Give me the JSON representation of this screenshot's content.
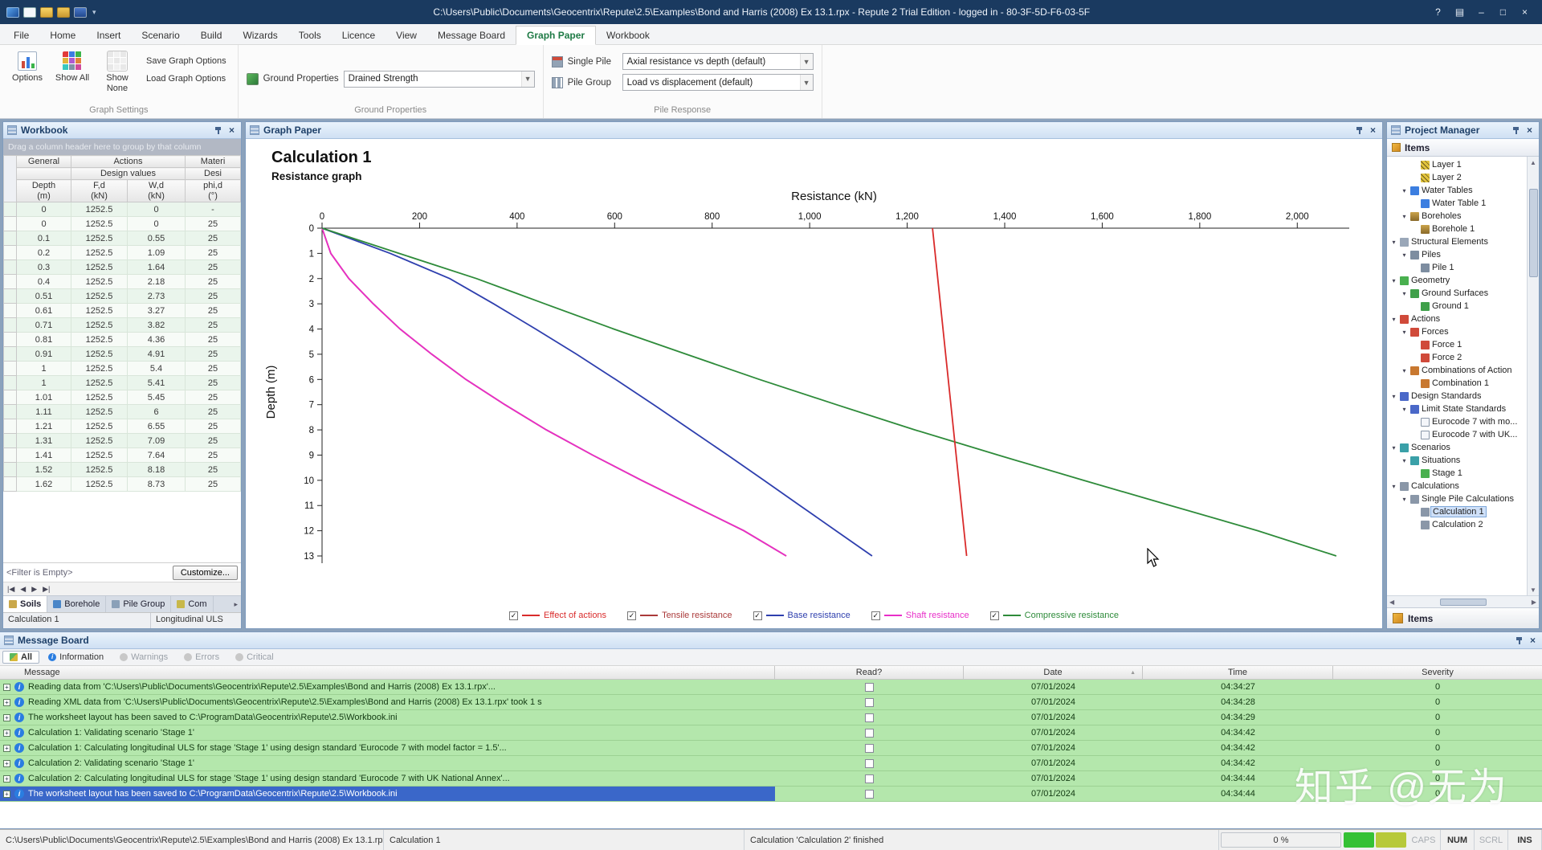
{
  "titlebar": {
    "title": "C:\\Users\\Public\\Documents\\Geocentrix\\Repute\\2.5\\Examples\\Bond and Harris (2008) Ex 13.1.rpx - Repute 2 Trial Edition - logged in - 80-3F-5D-F6-03-5F",
    "help": "?"
  },
  "menu": {
    "items": [
      "File",
      "Home",
      "Insert",
      "Scenario",
      "Build",
      "Wizards",
      "Tools",
      "Licence",
      "View",
      "Message Board",
      "Graph Paper",
      "Workbook"
    ],
    "active": "Graph Paper"
  },
  "ribbon": {
    "graph_settings": {
      "label": "Graph Settings",
      "options": "Options",
      "show_all": "Show All",
      "show_none": "Show None",
      "save": "Save Graph Options",
      "load": "Load Graph Options"
    },
    "ground_properties": {
      "label": "Ground Properties",
      "field_label": "Ground Properties",
      "value": "Drained Strength"
    },
    "pile_response": {
      "label": "Pile Response",
      "single_pile_label": "Single Pile",
      "single_pile_value": "Axial resistance vs depth (default)",
      "pile_group_label": "Pile Group",
      "pile_group_value": "Load vs displacement (default)"
    }
  },
  "workbook": {
    "title": "Workbook",
    "group_hint": "Drag a column header here to group by that column",
    "header": {
      "general": "General",
      "actions": "Actions",
      "materials": "Materi",
      "design_values": "Design values",
      "design2": "Desi"
    },
    "columns": [
      {
        "l1": "Depth",
        "l2": "(m)"
      },
      {
        "l1": "F,d",
        "l2": "(kN)"
      },
      {
        "l1": "W,d",
        "l2": "(kN)"
      },
      {
        "l1": "phi,d",
        "l2": "(°)"
      }
    ],
    "rows": [
      [
        "0",
        "1252.5",
        "0",
        "-"
      ],
      [
        "0",
        "1252.5",
        "0",
        "25"
      ],
      [
        "0.1",
        "1252.5",
        "0.55",
        "25"
      ],
      [
        "0.2",
        "1252.5",
        "1.09",
        "25"
      ],
      [
        "0.3",
        "1252.5",
        "1.64",
        "25"
      ],
      [
        "0.4",
        "1252.5",
        "2.18",
        "25"
      ],
      [
        "0.51",
        "1252.5",
        "2.73",
        "25"
      ],
      [
        "0.61",
        "1252.5",
        "3.27",
        "25"
      ],
      [
        "0.71",
        "1252.5",
        "3.82",
        "25"
      ],
      [
        "0.81",
        "1252.5",
        "4.36",
        "25"
      ],
      [
        "0.91",
        "1252.5",
        "4.91",
        "25"
      ],
      [
        "1",
        "1252.5",
        "5.4",
        "25"
      ],
      [
        "1",
        "1252.5",
        "5.41",
        "25"
      ],
      [
        "1.01",
        "1252.5",
        "5.45",
        "25"
      ],
      [
        "1.11",
        "1252.5",
        "6",
        "25"
      ],
      [
        "1.21",
        "1252.5",
        "6.55",
        "25"
      ],
      [
        "1.31",
        "1252.5",
        "7.09",
        "25"
      ],
      [
        "1.41",
        "1252.5",
        "7.64",
        "25"
      ],
      [
        "1.52",
        "1252.5",
        "8.18",
        "25"
      ],
      [
        "1.62",
        "1252.5",
        "8.73",
        "25"
      ]
    ],
    "filter": "<Filter is Empty>",
    "customize": "Customize...",
    "tabs": [
      "Soils",
      "Borehole",
      "Pile Group",
      "Com"
    ],
    "status_left": "Calculation 1",
    "status_right": "Longitudinal ULS"
  },
  "graph": {
    "panel_title": "Graph Paper"
  },
  "chart_data": {
    "type": "line",
    "title": "Calculation 1",
    "subtitle": "Resistance graph",
    "xlabel": "Resistance (kN)",
    "ylabel": "Depth (m)",
    "xlim": [
      0,
      2100
    ],
    "ylim": [
      0,
      13
    ],
    "x_ticks": [
      {
        "v": 0,
        "label": "0"
      },
      {
        "v": 200,
        "label": "200"
      },
      {
        "v": 400,
        "label": "400"
      },
      {
        "v": 600,
        "label": "600"
      },
      {
        "v": 800,
        "label": "800"
      },
      {
        "v": 1000,
        "label": "1,000"
      },
      {
        "v": 1200,
        "label": "1,200"
      },
      {
        "v": 1400,
        "label": "1,400"
      },
      {
        "v": 1600,
        "label": "1,600"
      },
      {
        "v": 1800,
        "label": "1,800"
      },
      {
        "v": 2000,
        "label": "2,000"
      }
    ],
    "y_ticks": [
      0,
      1,
      2,
      3,
      4,
      5,
      6,
      7,
      8,
      9,
      10,
      11,
      12,
      13
    ],
    "legend_position": "bottom",
    "grid": false,
    "series": [
      {
        "name": "Effect of actions",
        "color": "#d92b2b",
        "checked": true,
        "points": [
          [
            1252,
            0
          ],
          [
            1322,
            13
          ]
        ]
      },
      {
        "name": "Tensile resistance",
        "color": "#aa3a3a",
        "checked": true,
        "points": [
          [
            0,
            0
          ],
          [
            18,
            1
          ],
          [
            55,
            2
          ],
          [
            105,
            3
          ],
          [
            160,
            4
          ],
          [
            225,
            5
          ],
          [
            295,
            6
          ],
          [
            375,
            7
          ],
          [
            460,
            8
          ],
          [
            555,
            9
          ],
          [
            655,
            10
          ],
          [
            760,
            11
          ],
          [
            865,
            12
          ],
          [
            952,
            13
          ]
        ]
      },
      {
        "name": "Base resistance",
        "color": "#2e3fae",
        "checked": true,
        "points": [
          [
            0,
            0
          ],
          [
            140,
            1
          ],
          [
            262,
            2
          ],
          [
            352,
            3
          ],
          [
            438,
            4
          ],
          [
            522,
            5
          ],
          [
            602,
            6
          ],
          [
            680,
            7
          ],
          [
            756,
            8
          ],
          [
            832,
            9
          ],
          [
            906,
            10
          ],
          [
            980,
            11
          ],
          [
            1054,
            12
          ],
          [
            1128,
            13
          ]
        ]
      },
      {
        "name": "Shaft resistance",
        "color": "#e82ec8",
        "checked": true,
        "points": [
          [
            0,
            0
          ],
          [
            18,
            1
          ],
          [
            55,
            2
          ],
          [
            105,
            3
          ],
          [
            160,
            4
          ],
          [
            225,
            5
          ],
          [
            295,
            6
          ],
          [
            375,
            7
          ],
          [
            460,
            8
          ],
          [
            555,
            9
          ],
          [
            655,
            10
          ],
          [
            760,
            11
          ],
          [
            865,
            12
          ],
          [
            952,
            13
          ]
        ]
      },
      {
        "name": "Compressive resistance",
        "color": "#2e8b3a",
        "checked": true,
        "points": [
          [
            0,
            0
          ],
          [
            158,
            1
          ],
          [
            317,
            2
          ],
          [
            457,
            3
          ],
          [
            598,
            4
          ],
          [
            747,
            5
          ],
          [
            897,
            6
          ],
          [
            1055,
            7
          ],
          [
            1216,
            8
          ],
          [
            1387,
            9
          ],
          [
            1561,
            10
          ],
          [
            1740,
            11
          ],
          [
            1919,
            12
          ],
          [
            2080,
            13
          ]
        ]
      }
    ]
  },
  "project_manager": {
    "title": "Project Manager",
    "items_header": "Items",
    "items_button": "Items",
    "tree": [
      {
        "label": "Layer 1",
        "level": 2,
        "icon": "layer"
      },
      {
        "label": "Layer 2",
        "level": 2,
        "icon": "layer"
      },
      {
        "label": "Water Tables",
        "level": 1,
        "icon": "water-tables",
        "expand": true
      },
      {
        "label": "Water Table 1",
        "level": 2,
        "icon": "water-table"
      },
      {
        "label": "Boreholes",
        "level": 1,
        "icon": "boreholes",
        "expand": true
      },
      {
        "label": "Borehole 1",
        "level": 2,
        "icon": "borehole"
      },
      {
        "label": "Structural Elements",
        "level": 0,
        "icon": "structural",
        "expand": true
      },
      {
        "label": "Piles",
        "level": 1,
        "icon": "piles",
        "expand": true
      },
      {
        "label": "Pile 1",
        "level": 2,
        "icon": "pile"
      },
      {
        "label": "Geometry",
        "level": 0,
        "icon": "geometry",
        "expand": true
      },
      {
        "label": "Ground Surfaces",
        "level": 1,
        "icon": "ground-surfaces",
        "expand": true
      },
      {
        "label": "Ground 1",
        "level": 2,
        "icon": "ground"
      },
      {
        "label": "Actions",
        "level": 0,
        "icon": "actions",
        "expand": true
      },
      {
        "label": "Forces",
        "level": 1,
        "icon": "forces",
        "expand": true
      },
      {
        "label": "Force 1",
        "level": 2,
        "icon": "force"
      },
      {
        "label": "Force 2",
        "level": 2,
        "icon": "force"
      },
      {
        "label": "Combinations of Action",
        "level": 1,
        "icon": "combinations",
        "expand": true
      },
      {
        "label": "Combination 1",
        "level": 2,
        "icon": "combination"
      },
      {
        "label": "Design Standards",
        "level": 0,
        "icon": "design-standards",
        "expand": true
      },
      {
        "label": "Limit State Standards",
        "level": 1,
        "icon": "limit-state",
        "expand": true
      },
      {
        "label": "Eurocode 7 with mo...",
        "level": 2,
        "icon": "eurocode"
      },
      {
        "label": "Eurocode 7 with UK...",
        "level": 2,
        "icon": "eurocode"
      },
      {
        "label": "Scenarios",
        "level": 0,
        "icon": "scenarios",
        "expand": true
      },
      {
        "label": "Situations",
        "level": 1,
        "icon": "situations",
        "expand": true
      },
      {
        "label": "Stage 1",
        "level": 2,
        "icon": "stage"
      },
      {
        "label": "Calculations",
        "level": 0,
        "icon": "calculations",
        "expand": true
      },
      {
        "label": "Single Pile Calculations",
        "level": 1,
        "icon": "single-pile",
        "expand": true
      },
      {
        "label": "Calculation 1",
        "level": 2,
        "icon": "calculation",
        "selected": true
      },
      {
        "label": "Calculation 2",
        "level": 2,
        "icon": "calculation"
      }
    ]
  },
  "message_board": {
    "title": "Message Board",
    "tabs": [
      "All",
      "Information",
      "Warnings",
      "Errors",
      "Critical"
    ],
    "active_tab": "All",
    "disabled_tabs": [
      "Warnings",
      "Errors",
      "Critical"
    ],
    "columns": [
      "Message",
      "Read?",
      "Date",
      "Time",
      "Severity"
    ],
    "rows": [
      {
        "message": "Reading data from 'C:\\Users\\Public\\Documents\\Geocentrix\\Repute\\2.5\\Examples\\Bond and Harris (2008) Ex 13.1.rpx'...",
        "date": "07/01/2024",
        "time": "04:34:27",
        "severity": "0"
      },
      {
        "message": "Reading XML data from 'C:\\Users\\Public\\Documents\\Geocentrix\\Repute\\2.5\\Examples\\Bond and Harris (2008) Ex 13.1.rpx' took 1 s",
        "date": "07/01/2024",
        "time": "04:34:28",
        "severity": "0"
      },
      {
        "message": "The worksheet layout has been saved to C:\\ProgramData\\Geocentrix\\Repute\\2.5\\Workbook.ini",
        "date": "07/01/2024",
        "time": "04:34:29",
        "severity": "0"
      },
      {
        "message": "Calculation 1: Validating scenario 'Stage 1'",
        "date": "07/01/2024",
        "time": "04:34:42",
        "severity": "0"
      },
      {
        "message": "Calculation 1: Calculating longitudinal ULS for stage 'Stage 1' using design standard 'Eurocode 7 with model factor = 1.5'...",
        "date": "07/01/2024",
        "time": "04:34:42",
        "severity": "0"
      },
      {
        "message": "Calculation 2: Validating scenario 'Stage 1'",
        "date": "07/01/2024",
        "time": "04:34:42",
        "severity": "0"
      },
      {
        "message": "Calculation 2: Calculating longitudinal ULS for stage 'Stage 1' using design standard 'Eurocode 7 with UK National Annex'...",
        "date": "07/01/2024",
        "time": "04:34:44",
        "severity": "0"
      },
      {
        "message": "The worksheet layout has been saved to C:\\ProgramData\\Geocentrix\\Repute\\2.5\\Workbook.ini",
        "date": "07/01/2024",
        "time": "04:34:44",
        "severity": "0",
        "selected": true
      }
    ]
  },
  "statusbar": {
    "left": "C:\\Users\\Public\\Documents\\Geocentrix\\Repute\\2.5\\Examples\\Bond and Harris (2008) Ex 13.1.rpx",
    "cell2": "Calculation 1",
    "middle": "Calculation 'Calculation 2' finished",
    "progress": "0 %",
    "status_lights": [
      "#35c135",
      "#b7c93a"
    ],
    "indicators": [
      {
        "label": "CAPS",
        "active": false
      },
      {
        "label": "NUM",
        "active": true
      },
      {
        "label": "SCRL",
        "active": false
      },
      {
        "label": "INS",
        "active": true
      }
    ]
  },
  "watermark": "知乎 @无为"
}
